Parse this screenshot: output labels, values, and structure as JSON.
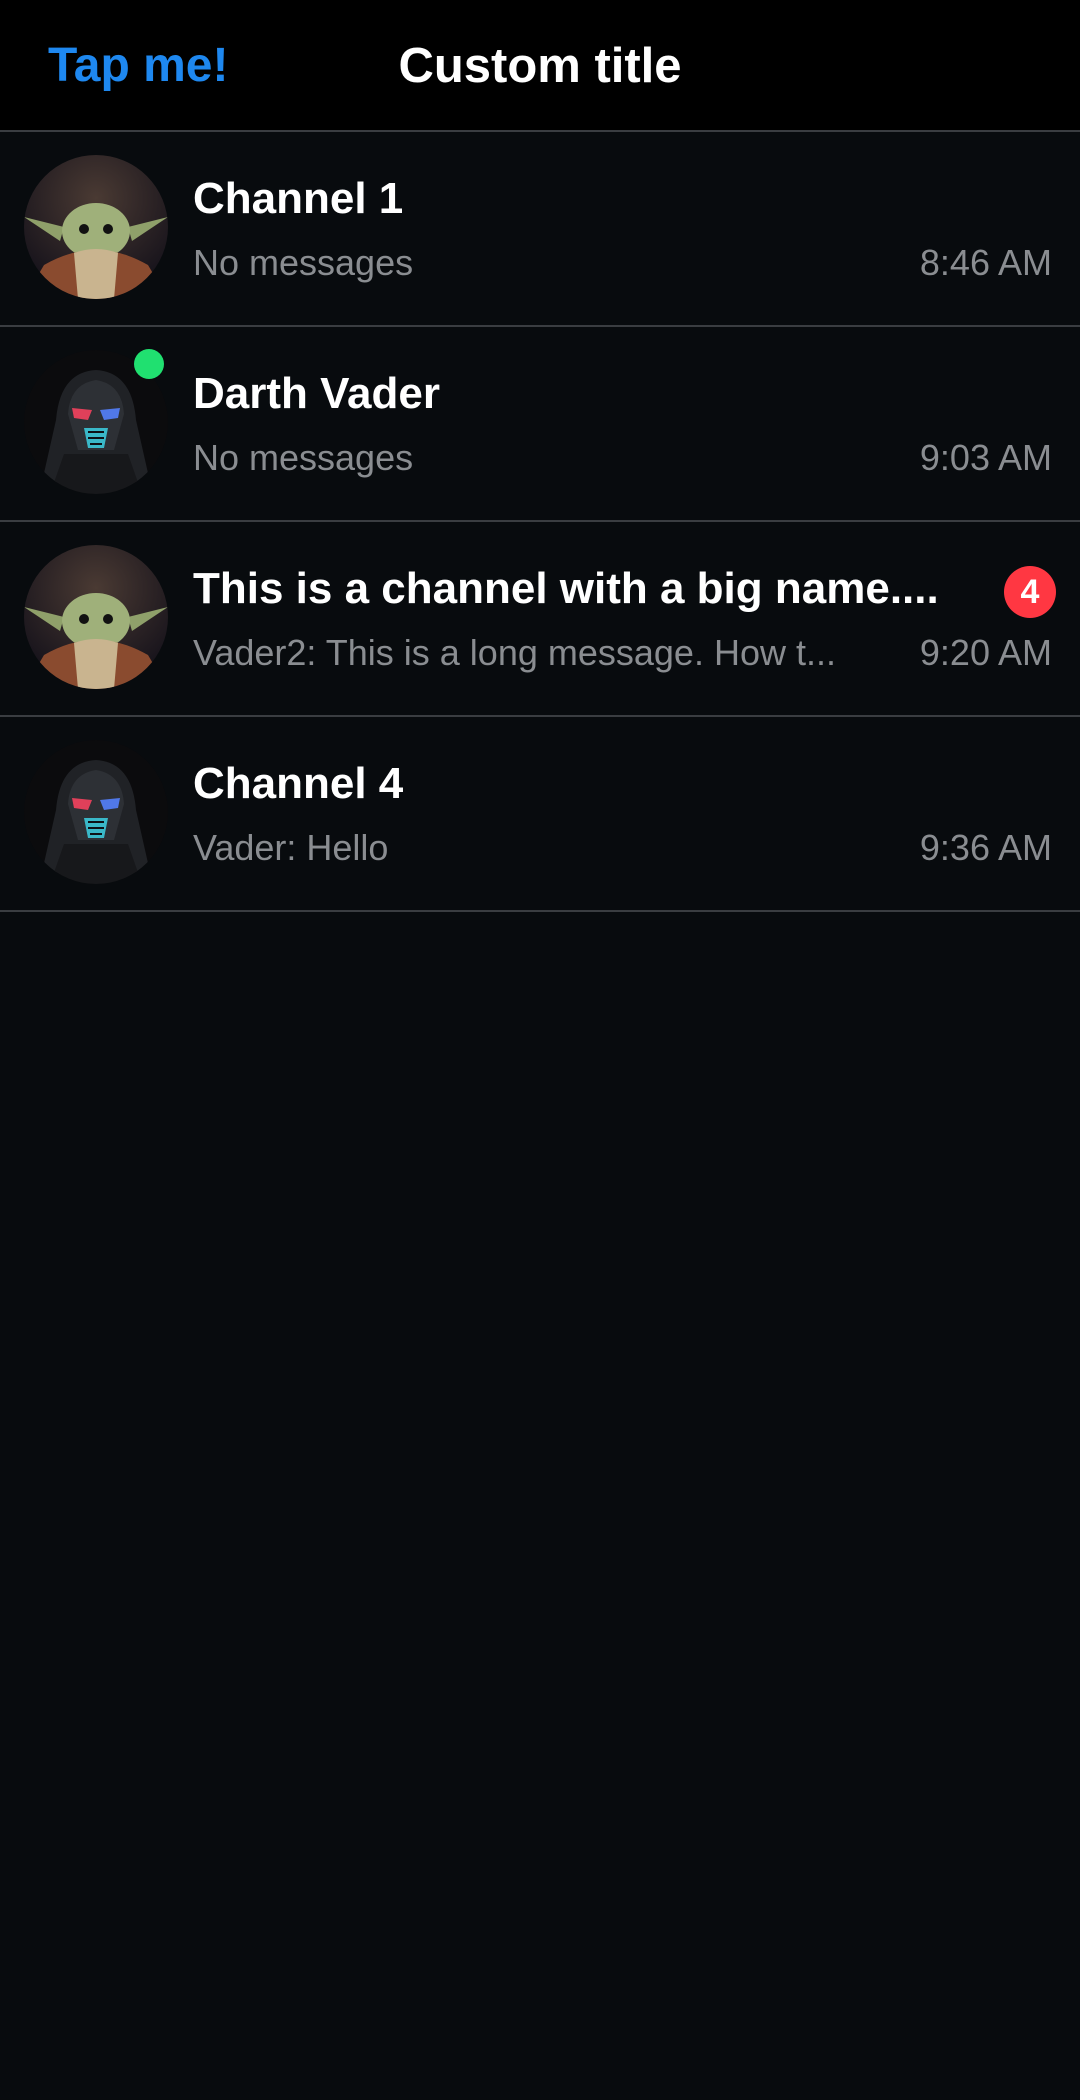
{
  "header": {
    "left_button_label": "Tap me!",
    "title": "Custom title"
  },
  "channels": [
    {
      "name": "Channel 1",
      "preview": "No messages",
      "time": "8:46 AM",
      "avatar_icon": "grogu-avatar-icon",
      "online": false,
      "unread": null
    },
    {
      "name": "Darth Vader",
      "preview": "No messages",
      "time": "9:03 AM",
      "avatar_icon": "vader-avatar-icon",
      "online": true,
      "unread": null
    },
    {
      "name": "This is a channel with a big name....",
      "preview": "Vader2: This is a long message. How t...",
      "time": "9:20 AM",
      "avatar_icon": "grogu-avatar-icon",
      "online": false,
      "unread": "4"
    },
    {
      "name": "Channel 4",
      "preview": "Vader: Hello",
      "time": "9:36 AM",
      "avatar_icon": "vader-avatar-icon",
      "online": false,
      "unread": null
    }
  ],
  "colors": {
    "accent": "#1e88f0",
    "background": "#080b0e",
    "header_background": "#000000",
    "online": "#20e070",
    "badge": "#ff3742",
    "secondary_text": "#8a8d91"
  }
}
